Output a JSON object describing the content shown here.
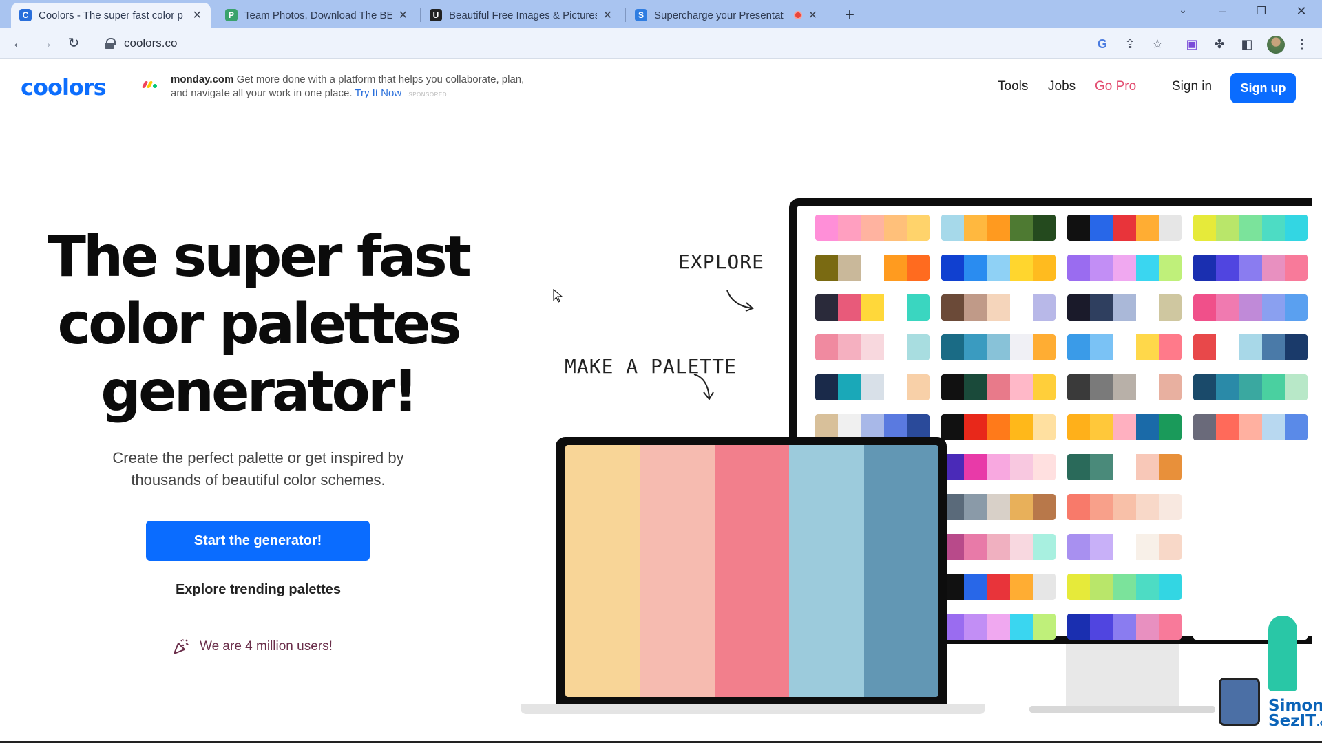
{
  "browser": {
    "tabs": [
      {
        "title": "Coolors - The super fast color p",
        "favicon": "C",
        "favicon_color": "#2a6fdb",
        "active": true
      },
      {
        "title": "Team Photos, Download The BE",
        "favicon": "P",
        "favicon_color": "#3aa26b",
        "active": false
      },
      {
        "title": "Beautiful Free Images & Pictures",
        "favicon": "U",
        "favicon_color": "#222222",
        "active": false
      },
      {
        "title": "Supercharge your Presentat",
        "favicon": "S",
        "favicon_color": "#2f7de1",
        "active": false
      }
    ],
    "url": "coolors.co"
  },
  "header": {
    "logo": "coolors",
    "ad": {
      "brand": "monday.com",
      "text": "Get more done with a platform that helps you collaborate, plan, and navigate all your work in one place.",
      "cta": "Try It Now",
      "tag": "SPONSORED"
    },
    "nav": {
      "tools": "Tools",
      "jobs": "Jobs",
      "go_pro": "Go Pro",
      "sign_in": "Sign in",
      "sign_up": "Sign up"
    }
  },
  "hero": {
    "title_line1": "The super fast",
    "title_line2": "color palettes",
    "title_line3": "generator!",
    "subtitle": "Create the perfect palette or get inspired by thousands of beautiful color schemes.",
    "cta": "Start the generator!",
    "explore_link": "Explore trending palettes",
    "users": "We are 4 million users!"
  },
  "illustration": {
    "explore_label": "EXPLORE",
    "make_label": "MAKE A PALETTE",
    "laptop_palette": [
      "#f8d597",
      "#f6bbb0",
      "#f27f8c",
      "#9ccbdc",
      "#6297b4"
    ],
    "monitor_palettes": [
      [
        [
          "#ff8fd8",
          "#ff9fc0",
          "#ffb3a0",
          "#ffc07a",
          "#ffd36b"
        ],
        [
          "#a6d9ea",
          "#ffb83f",
          "#ff9a1f",
          "#4e7a32",
          "#244a1e"
        ],
        [
          "#111111",
          "#2867e8",
          "#e8343a",
          "#ffad33",
          "#e6e6e6"
        ],
        [
          "#e6ea3a",
          "#b9e66a",
          "#7be39b",
          "#4ddcc4",
          "#33d6e3"
        ]
      ],
      [
        [
          "#7a6a12",
          "#c9b89a",
          "#ffffff",
          "#ff9b1f",
          "#ff6b1f"
        ],
        [
          "#1040d0",
          "#2a8cf0",
          "#8fd1f5",
          "#ffd62e",
          "#ffbb1f"
        ],
        [
          "#9a6cf0",
          "#c28ef5",
          "#f0a8f0",
          "#3ad6f0",
          "#bff07a"
        ],
        [
          "#1a2fb0",
          "#5045e0",
          "#8a7cf0",
          "#e890c0",
          "#f87a9a"
        ]
      ],
      [
        [
          "#2a2a3a",
          "#e85a7a",
          "#ffd83a",
          "#ffffff",
          "#3ad6c0"
        ],
        [
          "#6b4a38",
          "#c09a88",
          "#f5d5bb",
          "#ffffff",
          "#b8b8e8"
        ],
        [
          "#1a1a2a",
          "#2f3f5f",
          "#aab8d8",
          "#ffffff",
          "#cfc7a0"
        ],
        [
          "#f0508a",
          "#f07ab0",
          "#c08ad8",
          "#8aa0f0",
          "#5aa0f0"
        ]
      ],
      [
        [
          "#f08aa0",
          "#f5b0c0",
          "#f8d8de",
          "#ffffff",
          "#a8dde0"
        ],
        [
          "#1a6b85",
          "#3a9bc0",
          "#88c2d8",
          "#f0f0f5",
          "#ffad33"
        ],
        [
          "#3a9be8",
          "#7ac2f5",
          "#ffffff",
          "#ffd84a",
          "#ff7a8a"
        ],
        [
          "#e8484a",
          "#ffffff",
          "#a8d8e8",
          "#4a7aa8",
          "#1a3a6a"
        ]
      ],
      [
        [
          "#1a2a4a",
          "#1aa8b8",
          "#d8e0e8",
          "#ffffff",
          "#f8d0a8"
        ],
        [
          "#111111",
          "#1a4a3a",
          "#e87a8a",
          "#ffb8c8",
          "#ffcf3a"
        ],
        [
          "#3a3a3a",
          "#7a7a7a",
          "#b8b0a8",
          "#ffffff",
          "#e8b0a0"
        ],
        [
          "#1a4a6a",
          "#2a8aa8",
          "#3aa8a0",
          "#4ad0a0",
          "#b8e8c8"
        ]
      ],
      [
        [
          "#d8c09a",
          "#f0f0f0",
          "#a8b8e8",
          "#5a7ae0",
          "#2a4a9a"
        ],
        [
          "#111111",
          "#e8281a",
          "#ff7a1a",
          "#ffb81a",
          "#ffe0a0"
        ],
        [
          "#ffb01a",
          "#ffc83a",
          "#ffb0c0",
          "#1a6aa8",
          "#1a9a5a"
        ],
        [
          "#6a6a7a",
          "#ff6a5a",
          "#ffb0a0",
          "#b8d8f0",
          "#5a8ae8"
        ]
      ],
      [
        [
          "#1a6a4a",
          "#ffffff",
          "#ffd01a",
          "#ff6a2a",
          "#e8283a"
        ],
        [
          "#4a2ab8",
          "#e83aa8",
          "#f8a8e0",
          "#f8c8e0",
          "#ffe0e0"
        ],
        [
          "#2a6a5a",
          "#4a8a7a",
          "#ffffff",
          "#f8c8b8",
          "#e8903a"
        ],
        [
          "#ffffff",
          "#ffffff",
          "#ffffff",
          "#ffffff",
          "#ffffff"
        ]
      ],
      [
        [
          "#7a8aa8",
          "#a8a8c8",
          "#d8d8e8",
          "#e8e0d0",
          "#d8c898"
        ],
        [
          "#5a6a7a",
          "#8a9aa8",
          "#d8d0c8",
          "#e8b05a",
          "#b8784a"
        ],
        [
          "#f87a6a",
          "#f8a08a",
          "#f8c0a8",
          "#f8d8c8",
          "#f8e8e0"
        ],
        [
          "#ffffff",
          "#ffffff",
          "#ffffff",
          "#ffffff",
          "#ffffff"
        ]
      ],
      [
        [
          "#e8908a",
          "#f0b0b0",
          "#e0e0f0",
          "#b8e8f0",
          "#a8f0f0"
        ],
        [
          "#b84a8a",
          "#e87aa8",
          "#f0b0c0",
          "#f8d8e0",
          "#a8f0e0"
        ],
        [
          "#a890f0",
          "#c8b0f8",
          "#ffffff",
          "#f8f0e8",
          "#f8d8c8"
        ],
        [
          "#ffffff",
          "#ffffff",
          "#ffffff",
          "#ffffff",
          "#ffffff"
        ]
      ],
      [
        [
          "#a6d9ea",
          "#ffb83f",
          "#ff9a1f",
          "#4e7a32",
          "#244a1e"
        ],
        [
          "#111111",
          "#2867e8",
          "#e8343a",
          "#ffad33",
          "#e6e6e6"
        ],
        [
          "#e6ea3a",
          "#b9e66a",
          "#7be39b",
          "#4ddcc4",
          "#33d6e3"
        ],
        [
          "#ffffff",
          "#ffffff",
          "#ffffff",
          "#ffffff",
          "#ffffff"
        ]
      ],
      [
        [
          "#1040d0",
          "#2a8cf0",
          "#8fd1f5",
          "#ffd62e",
          "#ffbb1f"
        ],
        [
          "#9a6cf0",
          "#c28ef5",
          "#f0a8f0",
          "#3ad6f0",
          "#bff07a"
        ],
        [
          "#1a2fb0",
          "#5045e0",
          "#8a7cf0",
          "#e890c0",
          "#f87a9a"
        ],
        [
          "#ffffff",
          "#ffffff",
          "#ffffff",
          "#ffffff",
          "#ffffff"
        ]
      ]
    ]
  },
  "watermark": {
    "line1": "Simon",
    "line2": "SezIT",
    "suffix": ".com"
  },
  "colors": {
    "brand_blue": "#0a6cff",
    "go_pro": "#e24a6e"
  }
}
